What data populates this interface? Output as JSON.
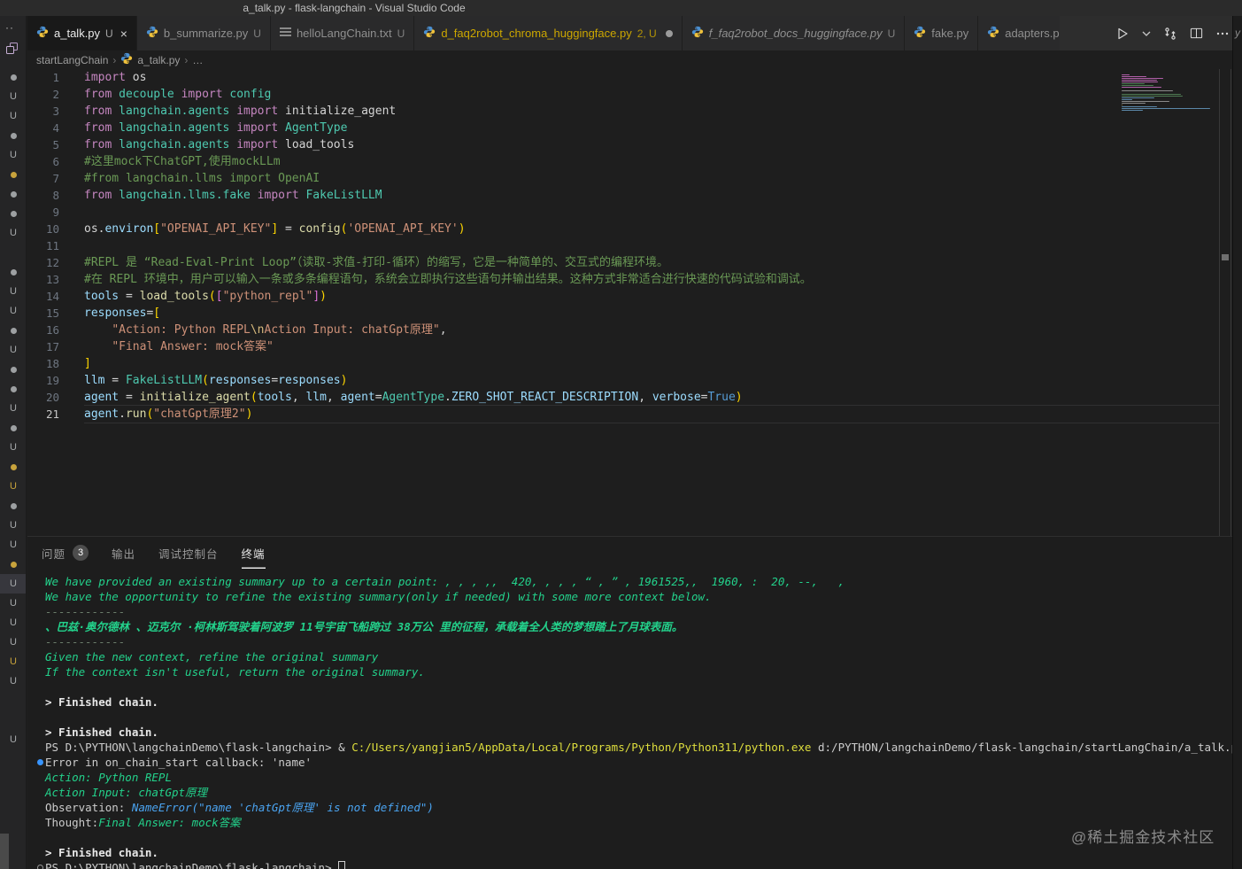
{
  "colors": {
    "terminal_green": "#23d18b",
    "terminal_blue": "#4aa3f0",
    "terminal_path_yellow": "#dede3d",
    "tab_warning_yellow": "#cca700",
    "git_badge_grey": "#9da0a2",
    "git_badge_yellow": "#c8a33c",
    "python_icon_blue": "#4a8fd1",
    "python_icon_yellow": "#f0c23c",
    "decoration_blue_dot": "#3794ff"
  },
  "title_bar": {
    "title": "a_talk.py - flask-langchain - Visual Studio Code"
  },
  "sidebar": {
    "more_label": "··",
    "badges": [
      "dot",
      "u",
      "u",
      "dot",
      "u",
      "ydot",
      "dot",
      "dot",
      "u",
      "gap",
      "dot",
      "u",
      "u",
      "dot",
      "u",
      "dot",
      "dot",
      "u",
      "dot",
      "u",
      "ydot",
      "yu",
      "dot",
      "u",
      "u",
      "ydot",
      "usel",
      "u",
      "u",
      "u",
      "yu",
      "u",
      "gap2",
      "u"
    ]
  },
  "tabs": [
    {
      "name": "a_talk.py",
      "icon": "python",
      "badge": "U",
      "active": true,
      "closable": true
    },
    {
      "name": "b_summarize.py",
      "icon": "python",
      "badge": "U"
    },
    {
      "name": "helloLangChain.txt",
      "icon": "text",
      "badge": "U"
    },
    {
      "name": "d_faq2robot_chroma_huggingface.py",
      "icon": "python",
      "badge": "2, U",
      "warning": true,
      "dirty": true
    },
    {
      "name": "f_faq2robot_docs_huggingface.py",
      "icon": "python",
      "badge": "U",
      "preview": true
    },
    {
      "name": "fake.py",
      "icon": "python",
      "badge": ""
    },
    {
      "name": "adapters.p",
      "icon": "python",
      "badge": "",
      "clipped": true
    }
  ],
  "editor_actions": [
    {
      "icon": "play-icon",
      "name": "run-button"
    },
    {
      "icon": "chevron-down-icon",
      "name": "run-dropdown"
    },
    {
      "icon": "sync-arrows-icon",
      "name": "sync-button"
    },
    {
      "icon": "split-editor-icon",
      "name": "split-editor-button"
    },
    {
      "icon": "ellipsis-icon",
      "name": "more-actions-button"
    }
  ],
  "stray_letter": "y",
  "breadcrumb": {
    "items": [
      "startLangChain",
      "a_talk.py",
      "…"
    ]
  },
  "code": {
    "current_line": 21,
    "lines": [
      {
        "n": 1,
        "segs": [
          [
            "kw",
            "import"
          ],
          [
            "pl",
            " os"
          ]
        ]
      },
      {
        "n": 2,
        "segs": [
          [
            "kw",
            "from"
          ],
          [
            "cls",
            " decouple"
          ],
          [
            "kw",
            " import"
          ],
          [
            "cls",
            " config"
          ]
        ]
      },
      {
        "n": 3,
        "segs": [
          [
            "kw",
            "from"
          ],
          [
            "cls",
            " langchain.agents"
          ],
          [
            "kw",
            " import"
          ],
          [
            "pl",
            " initialize_agent"
          ]
        ]
      },
      {
        "n": 4,
        "segs": [
          [
            "kw",
            "from"
          ],
          [
            "cls",
            " langchain.agents"
          ],
          [
            "kw",
            " import"
          ],
          [
            "cls",
            " AgentType"
          ]
        ]
      },
      {
        "n": 5,
        "segs": [
          [
            "kw",
            "from"
          ],
          [
            "cls",
            " langchain.agents"
          ],
          [
            "kw",
            " import"
          ],
          [
            "pl",
            " load_tools"
          ]
        ]
      },
      {
        "n": 6,
        "segs": [
          [
            "cm",
            "#这里mock下ChatGPT,使用mockLLm"
          ]
        ]
      },
      {
        "n": 7,
        "segs": [
          [
            "cm",
            "#from langchain.llms import OpenAI"
          ]
        ]
      },
      {
        "n": 8,
        "segs": [
          [
            "kw",
            "from"
          ],
          [
            "cls",
            " langchain.llms.fake"
          ],
          [
            "kw",
            " import"
          ],
          [
            "cls",
            " FakeListLLM"
          ]
        ]
      },
      {
        "n": 9,
        "segs": []
      },
      {
        "n": 10,
        "segs": [
          [
            "pl",
            "os."
          ],
          [
            "var",
            "environ"
          ],
          [
            "br",
            "["
          ],
          [
            "str",
            "\"OPENAI_API_KEY\""
          ],
          [
            "br",
            "]"
          ],
          [
            "pl",
            " = "
          ],
          [
            "fn",
            "config"
          ],
          [
            "br",
            "("
          ],
          [
            "str",
            "'OPENAI_API_KEY'"
          ],
          [
            "br",
            ")"
          ]
        ]
      },
      {
        "n": 11,
        "segs": []
      },
      {
        "n": 12,
        "segs": [
          [
            "cm",
            "#REPL 是 “Read-Eval-Print Loop”（读取-求值-打印-循环）的缩写，它是一种简单的、交互式的编程环境。"
          ]
        ]
      },
      {
        "n": 13,
        "segs": [
          [
            "cm",
            "#在 REPL 环境中，用户可以输入一条或多条编程语句，系统会立即执行这些语句并输出结果。这种方式非常适合进行快速的代码试验和调试。"
          ]
        ]
      },
      {
        "n": 14,
        "segs": [
          [
            "var",
            "tools"
          ],
          [
            "pl",
            " = "
          ],
          [
            "fn",
            "load_tools"
          ],
          [
            "br",
            "("
          ],
          [
            "br2",
            "["
          ],
          [
            "str",
            "\"python_repl\""
          ],
          [
            "br2",
            "]"
          ],
          [
            "br",
            ")"
          ]
        ]
      },
      {
        "n": 15,
        "segs": [
          [
            "var",
            "responses"
          ],
          [
            "pl",
            "="
          ],
          [
            "br",
            "["
          ]
        ]
      },
      {
        "n": 16,
        "segs": [
          [
            "pl",
            "    "
          ],
          [
            "str",
            "\"Action: Python REPL"
          ],
          [
            "esc",
            "\\n"
          ],
          [
            "str",
            "Action Input: chatGpt原理\""
          ],
          [
            "pl",
            ","
          ]
        ]
      },
      {
        "n": 17,
        "segs": [
          [
            "pl",
            "    "
          ],
          [
            "str",
            "\"Final Answer: mock答案\""
          ]
        ]
      },
      {
        "n": 18,
        "segs": [
          [
            "br",
            "]"
          ]
        ]
      },
      {
        "n": 19,
        "segs": [
          [
            "var",
            "llm"
          ],
          [
            "pl",
            " = "
          ],
          [
            "cls",
            "FakeListLLM"
          ],
          [
            "br",
            "("
          ],
          [
            "var",
            "responses"
          ],
          [
            "pl",
            "="
          ],
          [
            "var",
            "responses"
          ],
          [
            "br",
            ")"
          ]
        ]
      },
      {
        "n": 20,
        "segs": [
          [
            "var",
            "agent"
          ],
          [
            "pl",
            " = "
          ],
          [
            "fn",
            "initialize_agent"
          ],
          [
            "br",
            "("
          ],
          [
            "var",
            "tools"
          ],
          [
            "pl",
            ", "
          ],
          [
            "var",
            "llm"
          ],
          [
            "pl",
            ", "
          ],
          [
            "var",
            "agent"
          ],
          [
            "pl",
            "="
          ],
          [
            "cls",
            "AgentType"
          ],
          [
            "pl",
            "."
          ],
          [
            "var",
            "ZERO_SHOT_REACT_DESCRIPTION"
          ],
          [
            "pl",
            ", "
          ],
          [
            "var",
            "verbose"
          ],
          [
            "pl",
            "="
          ],
          [
            "kc",
            "True"
          ],
          [
            "br",
            ")"
          ]
        ]
      },
      {
        "n": 21,
        "segs": [
          [
            "var",
            "agent"
          ],
          [
            "pl",
            "."
          ],
          [
            "fn",
            "run"
          ],
          [
            "br",
            "("
          ],
          [
            "str",
            "\"chatGpt原理2\""
          ],
          [
            "br",
            ")"
          ]
        ]
      }
    ]
  },
  "panel": {
    "tabs": [
      {
        "label": "问题",
        "badge": "3"
      },
      {
        "label": "输出"
      },
      {
        "label": "调试控制台"
      },
      {
        "label": "终端",
        "active": true
      }
    ],
    "terminal": {
      "lines": [
        {
          "segs": [
            [
              "tg",
              "We have provided an existing summary up to a certain point: , , , ,,  420, , , , “ , ” , 1961525,,  1960, :  20, --,   ,"
            ]
          ]
        },
        {
          "segs": [
            [
              "tg",
              "We have the opportunity to refine the existing summary(only if needed) with some more context below."
            ]
          ]
        },
        {
          "segs": [
            [
              "tdm",
              "------------"
            ]
          ]
        },
        {
          "segs": [
            [
              "tgb",
              "、巴兹·奥尔德林 、迈克尔 ·柯林斯驾驶着阿波罗 11号宇宙飞船跨过 38万公 里的征程，承载着全人类的梦想踏上了月球表面。"
            ]
          ]
        },
        {
          "segs": [
            [
              "tdm",
              "------------"
            ]
          ]
        },
        {
          "segs": [
            [
              "tg",
              "Given the new context, refine the original summary"
            ]
          ]
        },
        {
          "segs": [
            [
              "tg",
              "If the context isn't useful, return the original summary."
            ]
          ]
        },
        {
          "segs": []
        },
        {
          "segs": [
            [
              "tb",
              "> Finished chain."
            ]
          ]
        },
        {
          "segs": []
        },
        {
          "segs": [
            [
              "tb",
              "> Finished chain."
            ]
          ]
        },
        {
          "segs": [
            [
              "tw",
              "PS D:\\PYTHON\\langchainDemo\\flask-langchain> & "
            ],
            [
              "ty",
              "C:/Users/yangjian5/AppData/Local/Programs/Python/Python311/python.exe"
            ],
            [
              "tw",
              " d:/PYTHON/langchainDemo/flask-langchain/startLangChain/a_talk.py"
            ]
          ]
        },
        {
          "marker": "dot",
          "segs": [
            [
              "tw",
              "Error in on_chain_start callback: 'name'"
            ]
          ]
        },
        {
          "segs": [
            [
              "tg",
              "Action: Python REPL"
            ]
          ]
        },
        {
          "segs": [
            [
              "tg",
              "Action Input: chatGpt原理"
            ]
          ]
        },
        {
          "segs": [
            [
              "tw",
              "Observation: "
            ],
            [
              "tbl",
              "NameError(\"name 'chatGpt原理' is not defined\")"
            ]
          ]
        },
        {
          "segs": [
            [
              "tw",
              "Thought:"
            ],
            [
              "tg",
              "Final Answer: mock答案"
            ]
          ]
        },
        {
          "segs": []
        },
        {
          "segs": [
            [
              "tb",
              "> Finished chain."
            ]
          ]
        },
        {
          "marker": "circle",
          "cursor": true,
          "segs": [
            [
              "tw",
              "PS D:\\PYTHON\\langchainDemo\\flask-langchain> "
            ]
          ]
        }
      ]
    }
  },
  "watermark": "@稀土掘金技术社区"
}
